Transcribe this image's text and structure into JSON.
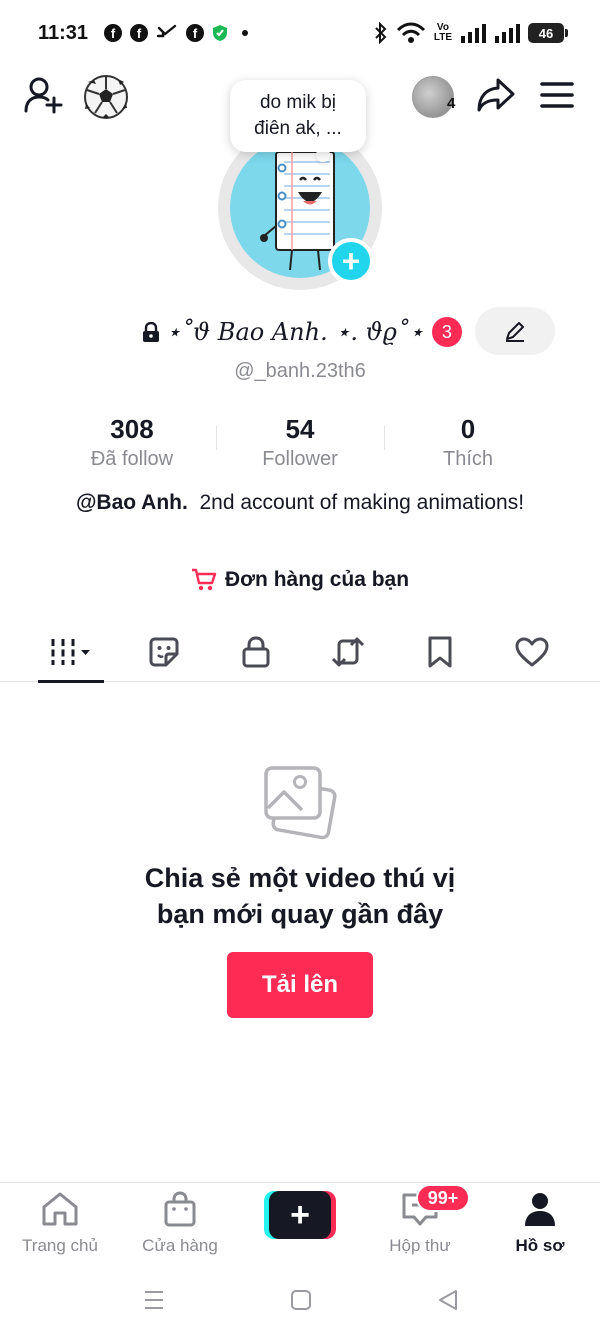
{
  "status_bar": {
    "time": "11:31",
    "volte_top": "Vo",
    "volte_bottom": "LTE",
    "battery": "46"
  },
  "header": {
    "viewer_count": "4",
    "note_text": "do mik bị điên ak, ..."
  },
  "profile": {
    "display_name": "⋆˚ϑ Bao Anh. ⋆. 𝜗𝜚˚⋆",
    "badge_count": "3",
    "username": "@_banh.23th6",
    "stats": [
      {
        "value": "308",
        "label": "Đã follow"
      },
      {
        "value": "54",
        "label": "Follower"
      },
      {
        "value": "0",
        "label": "Thích"
      }
    ],
    "bio_mention": "@Bao Anh.",
    "bio_text": "2nd account of making animations!",
    "orders_label": "Đơn hàng của bạn"
  },
  "tabs": [
    {
      "icon": "grid-icon",
      "active": true
    },
    {
      "icon": "sticker-icon",
      "active": false
    },
    {
      "icon": "lock-icon",
      "active": false
    },
    {
      "icon": "repost-icon",
      "active": false
    },
    {
      "icon": "bookmark-icon",
      "active": false
    },
    {
      "icon": "heart-icon",
      "active": false
    }
  ],
  "empty_state": {
    "title_line1": "Chia sẻ một video thú vị",
    "title_line2": "bạn mới quay gần đây",
    "upload_label": "Tải lên"
  },
  "bottom_nav": {
    "home": "Trang chủ",
    "shop": "Cửa hàng",
    "inbox": "Hộp thư",
    "inbox_badge": "99+",
    "profile": "Hồ sơ"
  },
  "colors": {
    "accent": "#fe2c55",
    "cyan": "#25f4ee",
    "avatar_bg": "#7dd8ec",
    "text_primary": "#161823",
    "text_secondary": "#8a8b91"
  }
}
